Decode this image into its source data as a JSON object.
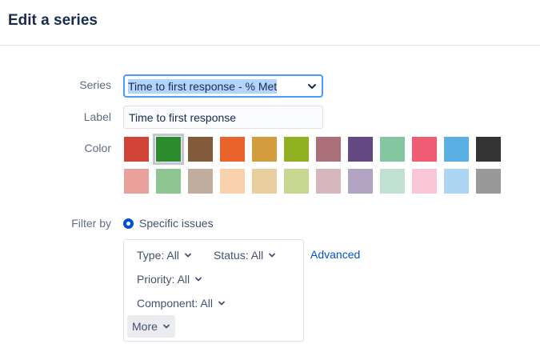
{
  "dialog": {
    "title": "Edit a series"
  },
  "form": {
    "series": {
      "label": "Series",
      "value": "Time to first response - % Met"
    },
    "label_field": {
      "label": "Label",
      "value": "Time to first response"
    },
    "color": {
      "label": "Color",
      "selected_index": 1,
      "swatches": [
        "#d04437",
        "#2c8b2c",
        "#815b3a",
        "#ea632b",
        "#d39c3f",
        "#8eb021",
        "#ac707a",
        "#654982",
        "#84c6a1",
        "#f15c75",
        "#59afe1",
        "#333333",
        "#e8a29b",
        "#8fc591",
        "#c0ad9e",
        "#f9d2ad",
        "#e9ce9f",
        "#c6d890",
        "#d5b7bd",
        "#b3a4c4",
        "#c1e2d2",
        "#f9c6d6",
        "#acd6f1",
        "#999999"
      ]
    },
    "filter": {
      "label": "Filter by",
      "option_label": "Specific issues",
      "buttons": {
        "type": "Type: All",
        "status": "Status: All",
        "priority": "Priority: All",
        "component": "Component: All",
        "more": "More"
      },
      "advanced_link": "Advanced"
    }
  }
}
